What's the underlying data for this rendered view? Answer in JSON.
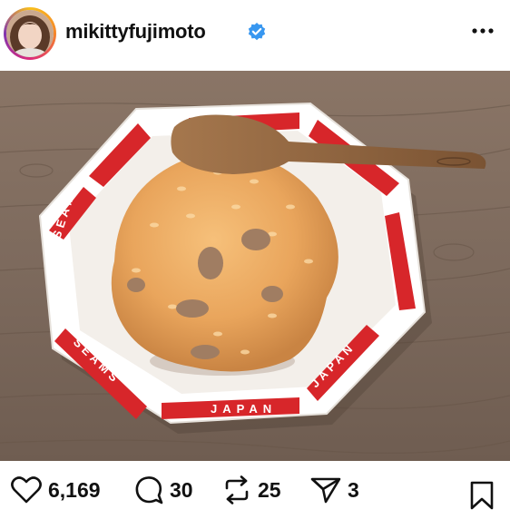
{
  "post": {
    "username": "mikittyfujimoto",
    "verified": true,
    "bowl_text": [
      "SEAMS",
      "JAPAN"
    ]
  },
  "actions": {
    "likes": "6,169",
    "comments": "30",
    "reposts": "25",
    "shares": "3"
  },
  "icons": [
    "avatar",
    "verified-badge-icon",
    "more-options-icon",
    "heart-icon",
    "comment-icon",
    "repost-icon",
    "send-icon",
    "bookmark-icon"
  ],
  "colors": {
    "verified": "#3897f0",
    "bowl_red": "#d7262a"
  }
}
